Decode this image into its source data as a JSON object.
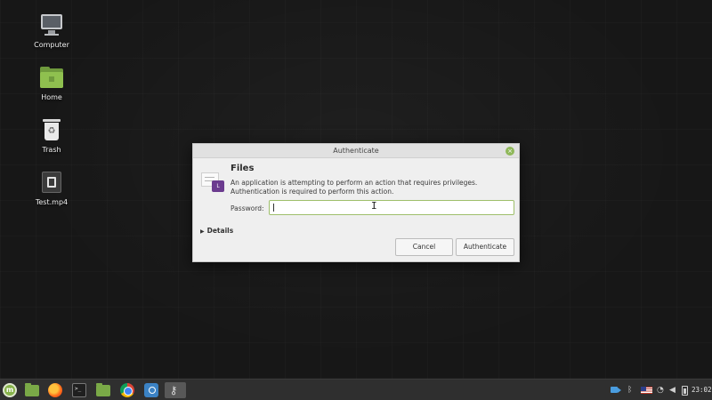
{
  "desktop": {
    "icons": [
      {
        "label": "Computer",
        "icon": "computer-icon"
      },
      {
        "label": "Home",
        "icon": "home-folder-icon"
      },
      {
        "label": "Trash",
        "icon": "trash-icon"
      },
      {
        "label": "Test.mp4",
        "icon": "video-file-icon"
      }
    ]
  },
  "dialog": {
    "window_title": "Authenticate",
    "app_name": "Files",
    "message": "An application is attempting to perform an action that requires privileges. Authentication is required to perform this action.",
    "password_label": "Password:",
    "password_value": "",
    "details_label": "Details",
    "cancel_label": "Cancel",
    "authenticate_label": "Authenticate",
    "accent_color": "#8fb85a"
  },
  "taskbar": {
    "launchers": [
      {
        "name": "menu-icon",
        "active": false
      },
      {
        "name": "files-icon",
        "active": false
      },
      {
        "name": "firefox-icon",
        "active": false
      },
      {
        "name": "terminal-icon",
        "active": false
      },
      {
        "name": "files-icon",
        "active": false
      },
      {
        "name": "chrome-icon",
        "active": false
      },
      {
        "name": "screenshot-icon",
        "active": false
      },
      {
        "name": "key-icon",
        "active": true
      }
    ],
    "tray": {
      "icons": [
        "video-recorder-icon",
        "bluetooth-icon",
        "us-flag-keyboard-icon",
        "wifi-icon",
        "volume-icon",
        "battery-icon"
      ],
      "clock": "23:02"
    }
  }
}
